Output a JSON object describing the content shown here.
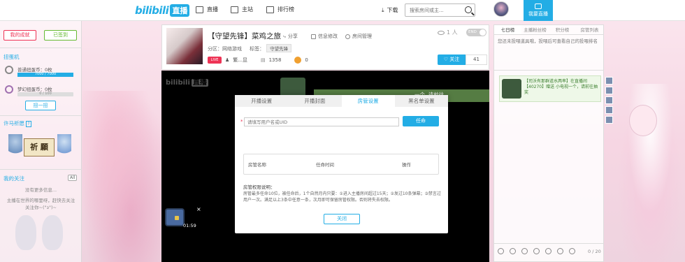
{
  "nav": {
    "logo_text": "bilibili",
    "logo_tag": "直播",
    "items": [
      {
        "label": "直播",
        "icon": "monitor-icon"
      },
      {
        "label": "主站",
        "icon": "tv-icon"
      },
      {
        "label": "排行榜",
        "icon": "ranking-icon"
      }
    ],
    "download_label": "下载",
    "search_placeholder": "搜索房间或主...",
    "golive_label": "我要直播"
  },
  "sidebar": {
    "my_achievements": "我的成就",
    "signed_in": "已签到",
    "gacha_title": "扭蛋机",
    "normal_egg": "普通扭蛋币：0枚",
    "normal_progress": "7000 / 7000",
    "dream_egg": "梦幻扭蛋币：0枚",
    "dream_progress": "0 / 100",
    "draw_button": "扭一扭",
    "wish_title": "许马祈愿",
    "wish_badge": "?",
    "wish_board": "祈 願",
    "follow_title": "我的关注",
    "all_label": "All",
    "empty_line1": "没有更多信息...",
    "empty_line2": "主播在世界的哪里呀，赶快去关注",
    "empty_line3": "关注你~(\"з\")~"
  },
  "room": {
    "title": "【守望先锋】菜鸡之旅",
    "share": "分享",
    "edit_info": "信息修改",
    "room_manage": "房间管理",
    "category": "分区：",
    "category_value": "网络游戏",
    "tag_label": "标签：",
    "tag_value": "守望先锋",
    "live_icon_text": "LIVE",
    "streamer": "繁...显",
    "fans": "1358",
    "coins": "0",
    "viewers": "1 人",
    "end_label": "END",
    "follow_label": "关注",
    "follow_count": "41"
  },
  "player": {
    "watermark": "bilibili",
    "watermark_tag": "直播",
    "banner_text": "一个, 请前往",
    "chest_time": "01:59",
    "chest_close": "×"
  },
  "modal": {
    "tabs": [
      "开播设置",
      "开播封面",
      "房管设置",
      "黑名单设置"
    ],
    "active_tab": 2,
    "required_star": "*",
    "uid_placeholder": "请填写用户名或UID",
    "appoint_button": "任命",
    "columns": [
      "房管名称",
      "任命时间",
      "操作"
    ],
    "permission_title": "房管权限说明：",
    "permission_desc": "房管最多任命10位，被任命后，1个自然月内只要：①进入主播房间超过15天；②发过10条弹幕；③禁言过用户一次。满足以上3条中任意一条，次月即可保留房管权限。否则将失去权限。",
    "close_button": "关闭"
  },
  "chat": {
    "tabs": [
      "七日榜",
      "主播粉丝榜",
      "积分榜",
      "房管列表"
    ],
    "active_tab": 0,
    "note": "您还未投喂道具哦，投喂后可查看自己的投喂排名",
    "gift_message": "【司沃有那群道水两率】在直播间【40270】赠送 小电视一个，请前往抽奖",
    "count": "0 / 20"
  }
}
